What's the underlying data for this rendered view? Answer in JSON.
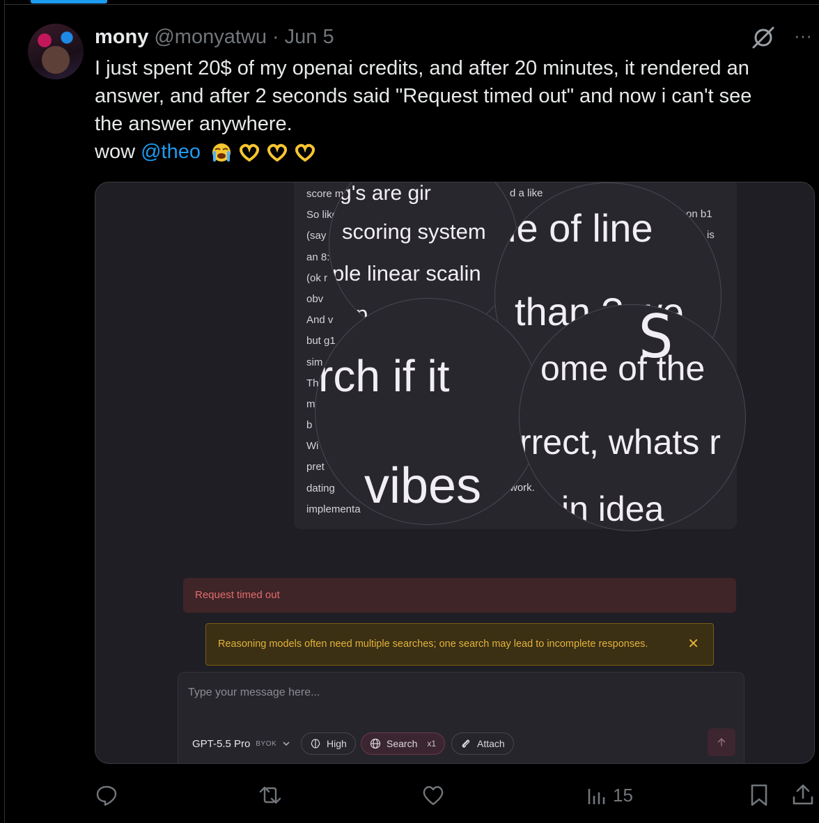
{
  "tweet": {
    "author_name": "mony",
    "handle": "@monyatwu",
    "separator": "·",
    "date": "Jun 5",
    "line1": "I just spent 20$ of my openai credits, and after 20 minutes, it rendered an",
    "line2": "answer, and after 2 seconds said \"Request timed out\" and now i can't see",
    "line3": "the answer anywhere.",
    "line4_prefix": "wow ",
    "mention": "@theo",
    "emojis": [
      "loudly-crying-face-emoji",
      "heart-hands-emoji",
      "heart-hands-emoji",
      "heart-hands-emoji"
    ]
  },
  "screenshot": {
    "doc_lines": [
      "score more",
      "So like s",
      "(say b",
      "an 8:",
      "(ok r",
      "obv",
      "And v",
      "but g1",
      "sim",
      "Th",
      "m",
      "b",
      "Wi",
      "pret",
      "dating",
      "implementa"
    ],
    "doc_right_fragments": [
      "d a like",
      "on b1",
      "is",
      "work."
    ],
    "magnifier_1": {
      "line1": "d g's are gir",
      "line2": "scoring system",
      "line3": "ple linear scalin",
      "line4": "mp"
    },
    "magnifier_2": {
      "line1": "le of line",
      "line2": "than ? we"
    },
    "magnifier_3": {
      "line1": "rch if it",
      "line2": "vibes"
    },
    "magnifier_4": {
      "line1": "S",
      "line2": "ome of the",
      "line3": "rrect, whats r",
      "line4": "in idea"
    },
    "error_text": "Request timed out",
    "warning_text": "Reasoning models often need multiple searches; one search may lead to incomplete responses.",
    "warning_close": "✕",
    "composer_placeholder": "Type your message here...",
    "model_name": "GPT-5.5 Pro",
    "model_tag": "BYOK",
    "reasoning_label": "High",
    "search_label": "Search",
    "search_count": "x1",
    "attach_label": "Attach"
  },
  "actions": {
    "views_count": "15"
  },
  "colors": {
    "accent_blue": "#1d9bf0",
    "muted": "#71767b",
    "error": "#e26d6d",
    "warning": "#e3b43a"
  }
}
